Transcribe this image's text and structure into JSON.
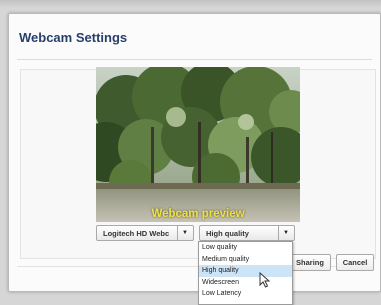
{
  "dialog": {
    "title": "Webcam Settings"
  },
  "preview": {
    "label": "Webcam preview"
  },
  "camera_select": {
    "value": "Logitech HD Webc"
  },
  "quality_select": {
    "value": "High quality",
    "options": [
      "Low quality",
      "Medium quality",
      "High quality",
      "Widescreen",
      "Low Latency"
    ],
    "highlighted_index": 2
  },
  "buttons": {
    "sharing": "Sharing",
    "cancel": "Cancel"
  },
  "icons": {
    "dropdown_arrow": "chevron-down-icon",
    "pointer": "mouse-pointer-icon"
  },
  "colors": {
    "title": "#27406b",
    "preview_label": "#f1e13f",
    "highlight": "#cde3f6"
  }
}
